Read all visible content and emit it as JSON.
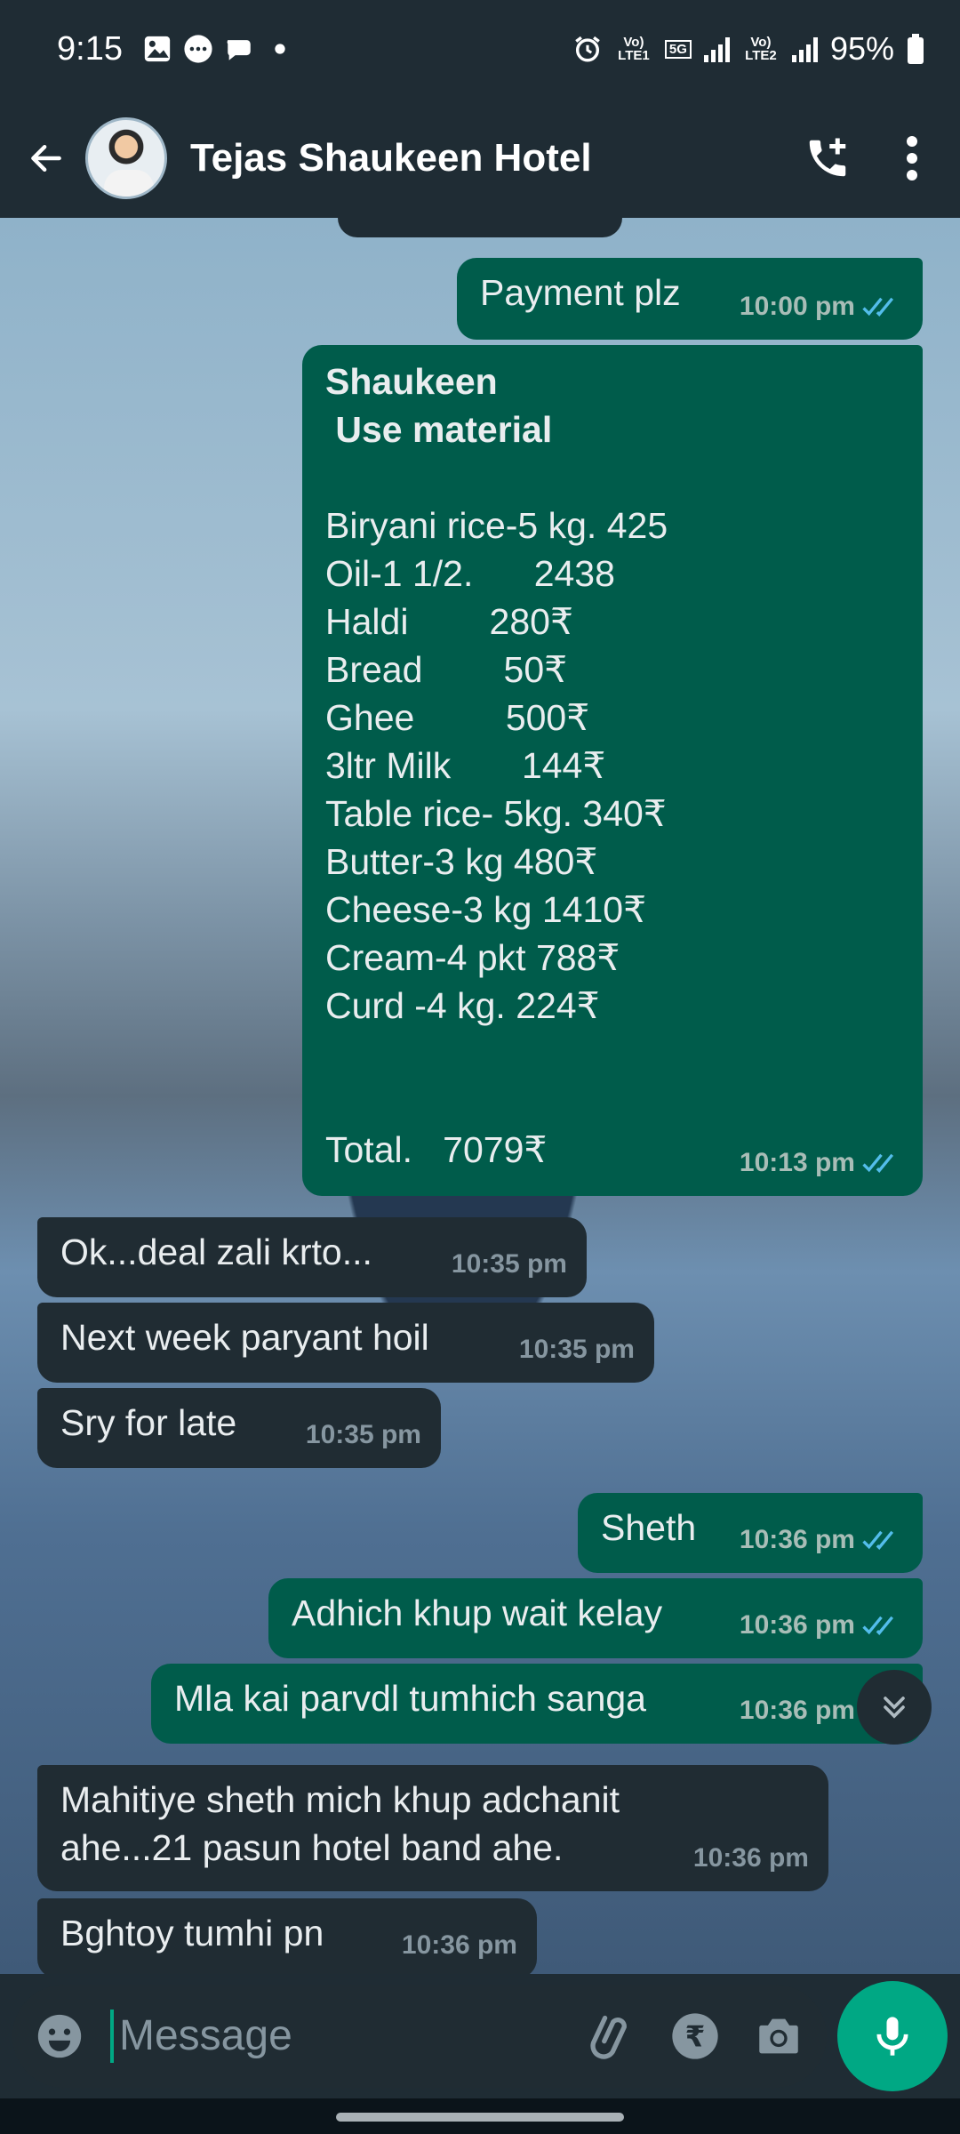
{
  "status_bar": {
    "time": "9:15",
    "battery": "95%",
    "sim1_label": "Vo) LTE1",
    "sim2_label": "Vo) LTE2",
    "network": "5G"
  },
  "header": {
    "title": "Tejas Shaukeen Hotel"
  },
  "messages": [
    {
      "text": "Payment plz",
      "time": "10:00 pm",
      "direction": "out"
    },
    {
      "heading1": "Shaukeen",
      "heading2": " Use material",
      "body": "Biryani rice-5 kg. 425\nOil-1 1/2.      2438\nHaldi        280₹\nBread        50₹\nGhee         500₹\n3ltr Milk       144₹\nTable rice- 5kg. 340₹\nButter-3 kg 480₹\nCheese-3 kg 1410₹\nCream-4 pkt 788₹\nCurd -4 kg. 224₹",
      "total": "Total.   7079₹",
      "time": "10:13 pm",
      "direction": "out"
    },
    {
      "text": "Ok...deal zali krto...",
      "time": "10:35 pm",
      "direction": "in"
    },
    {
      "text": "Next week paryant hoil",
      "time": "10:35 pm",
      "direction": "in"
    },
    {
      "text": "Sry for late",
      "time": "10:35 pm",
      "direction": "in"
    },
    {
      "text": "Sheth",
      "time": "10:36 pm",
      "direction": "out"
    },
    {
      "text": "Adhich khup wait kelay",
      "time": "10:36 pm",
      "direction": "out"
    },
    {
      "text": "Mla kai parvdl tumhich sanga",
      "time": "10:36 pm",
      "direction": "out"
    },
    {
      "text": "Mahitiye sheth mich khup adchanit\nahe...21 pasun hotel band ahe.",
      "time": "10:36 pm",
      "direction": "in"
    },
    {
      "text": "Bghtoy tumhi pn",
      "time": "10:36 pm",
      "direction": "in"
    }
  ],
  "composer": {
    "placeholder": "Message"
  },
  "colors": {
    "outgoing_bubble": "#005c4b",
    "incoming_bubble": "#202c33",
    "accent": "#00a884",
    "read_ticks": "#53bdeb"
  }
}
